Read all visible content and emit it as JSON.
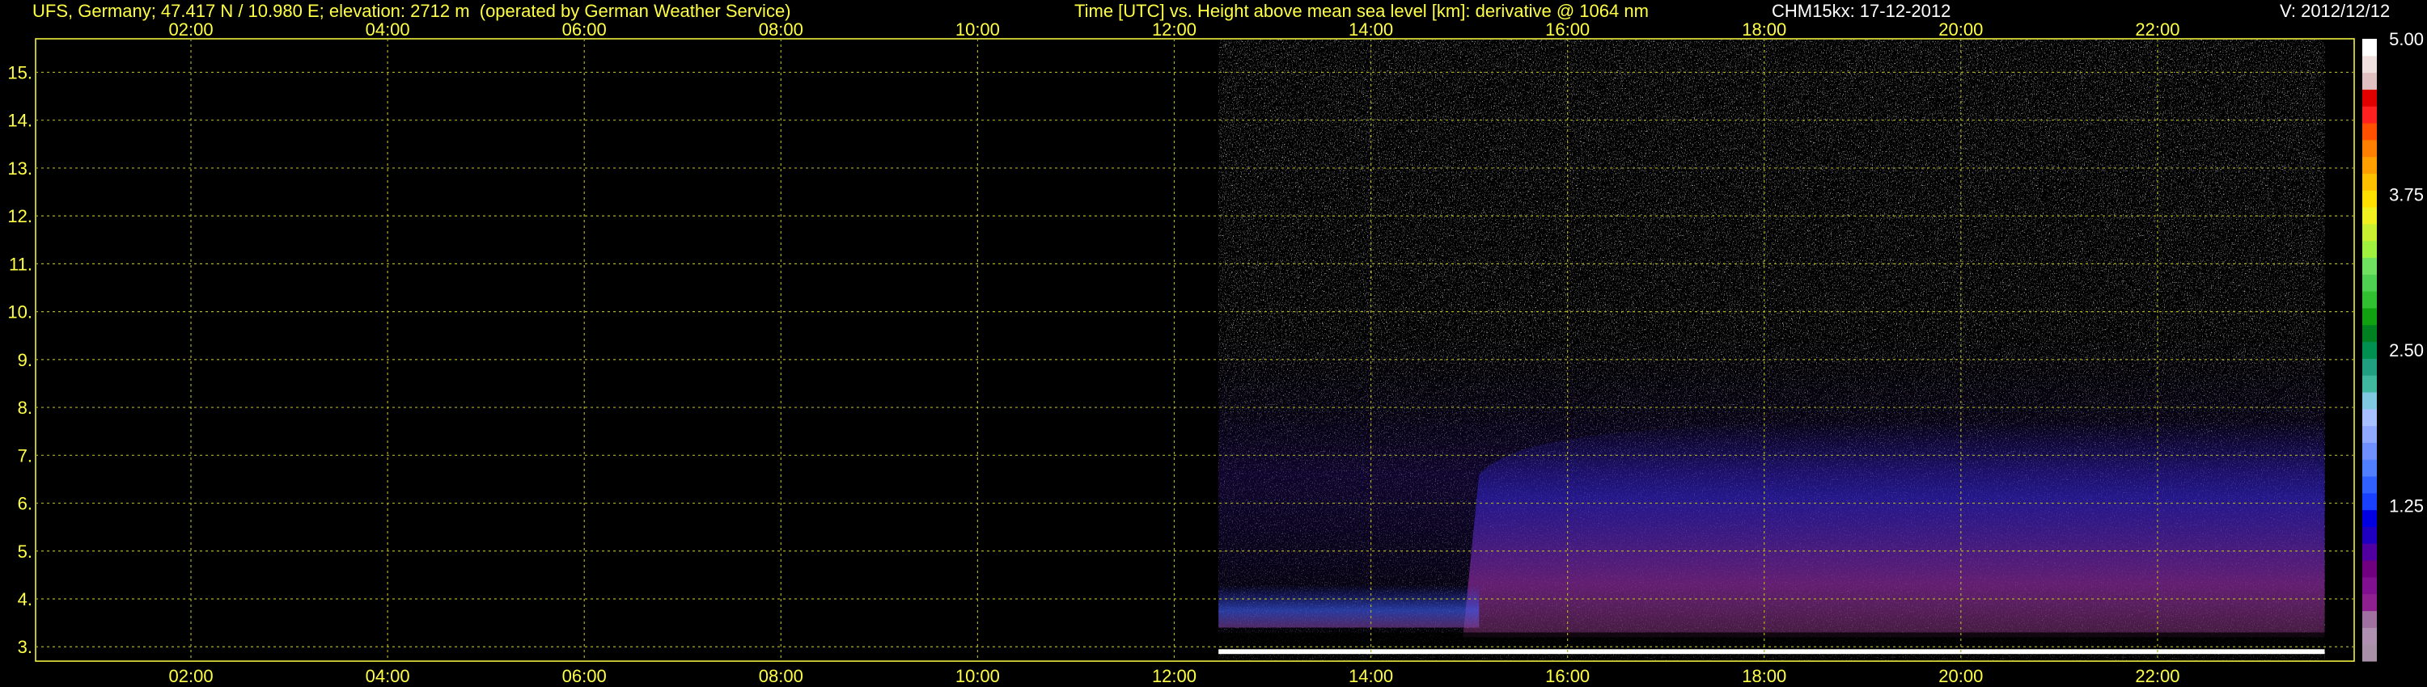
{
  "header": {
    "station": "UFS, Germany; 47.417 N / 10.980 E; elevation: 2712 m  (operated by German Weather Service)",
    "title": "Time [UTC] vs. Height above mean sea level [km]: derivative @ 1064 nm",
    "instrument": "CHM15kx: 17-12-2012",
    "version": "V: 2012/12/12"
  },
  "colors": {
    "axis": "#ffff44",
    "grid": "#b0b020",
    "background": "#000000",
    "signal_high": "#ffffff",
    "signal_mid": "#3b2fd0",
    "signal_low": "#8a2a9a"
  },
  "chart_data": {
    "type": "heatmap",
    "title": "Time [UTC] vs. Height above mean sea level [km]: derivative @ 1064 nm",
    "xlabel": "Time [UTC]",
    "ylabel": "Height above mean sea level [km]",
    "x_ticks": [
      "02:00",
      "04:00",
      "06:00",
      "08:00",
      "10:00",
      "12:00",
      "14:00",
      "16:00",
      "18:00",
      "20:00",
      "22:00"
    ],
    "x_tick_hours": [
      2,
      4,
      6,
      8,
      10,
      12,
      14,
      16,
      18,
      20,
      22
    ],
    "xlim_hours": [
      0.42,
      24
    ],
    "y_ticks": [
      "3.",
      "4.",
      "5.",
      "6.",
      "7.",
      "8.",
      "9.",
      "10.",
      "11.",
      "12.",
      "13.",
      "14.",
      "15."
    ],
    "y_tick_values": [
      3,
      4,
      5,
      6,
      7,
      8,
      9,
      10,
      11,
      12,
      13,
      14,
      15
    ],
    "ylim_km": [
      2.7,
      15.7
    ],
    "grid": true,
    "data_start_hour": 12.45,
    "data_end_hour": 23.7,
    "colorbar": {
      "min": 0,
      "max": 5,
      "tick_labels": [
        "5.00",
        "3.75",
        "2.50",
        "1.25"
      ],
      "tick_values": [
        5.0,
        3.75,
        2.5,
        1.25
      ],
      "colors": [
        "#a890a8",
        "#b090b0",
        "#a070a0",
        "#902090",
        "#801090",
        "#700080",
        "#5000a0",
        "#2000c0",
        "#0000e0",
        "#1a40ff",
        "#3060ff",
        "#5080ff",
        "#7090ff",
        "#90a8ff",
        "#a8c0ff",
        "#80c8e0",
        "#40b8a0",
        "#20a080",
        "#009050",
        "#008020",
        "#10a010",
        "#30c030",
        "#50d050",
        "#70e060",
        "#a0f040",
        "#c8f030",
        "#f0f020",
        "#ffe000",
        "#ffc000",
        "#ffa000",
        "#ff8000",
        "#ff5000",
        "#ff2020",
        "#e00000",
        "#e0c0c0",
        "#f0e0e0",
        "#ffffff"
      ]
    }
  }
}
